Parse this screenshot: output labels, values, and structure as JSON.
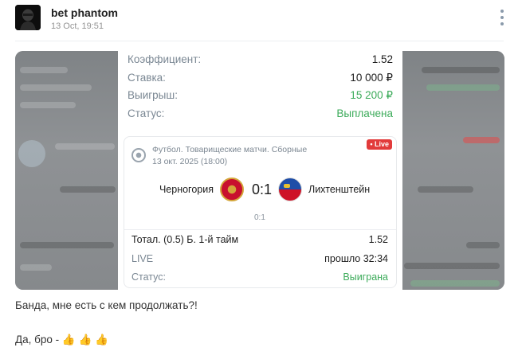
{
  "post": {
    "channel_name": "bet phantom",
    "time": "13 Oct, 19:51",
    "menu_icon": "kebab-menu-icon",
    "avatar_icon": "hooded-figure-avatar"
  },
  "receipt": {
    "coef_label": "Коэффициент:",
    "coef_value": "1.52",
    "stake_label": "Ставка:",
    "stake_value": "10 000 ₽",
    "win_label": "Выигрыш:",
    "win_value": "15 200 ₽",
    "status_label": "Статус:",
    "status_value": "Выплачена"
  },
  "event": {
    "sport_icon": "football-icon",
    "league": "Футбол. Товарищеские матчи. Сборные",
    "date": "13 окт. 2025 (18:00)",
    "live_badge": "• Live",
    "team_a": "Черногория",
    "team_b": "Лихтенштейн",
    "score": "0:1",
    "period_score": "0:1",
    "market_label": "Тотал. (0.5) Б. 1-й тайм",
    "market_value": "1.52",
    "live_label": "LIVE",
    "elapsed": "прошло 32:34",
    "status_label": "Статус:",
    "status_value": "Выиграна"
  },
  "captions": {
    "line1": "Банда, мне есть с кем продолжать?!",
    "line2": "Да, бро - 👍 👍 👍"
  },
  "colors": {
    "accent_green": "#3cab5a",
    "live_red": "#e23b3b"
  }
}
